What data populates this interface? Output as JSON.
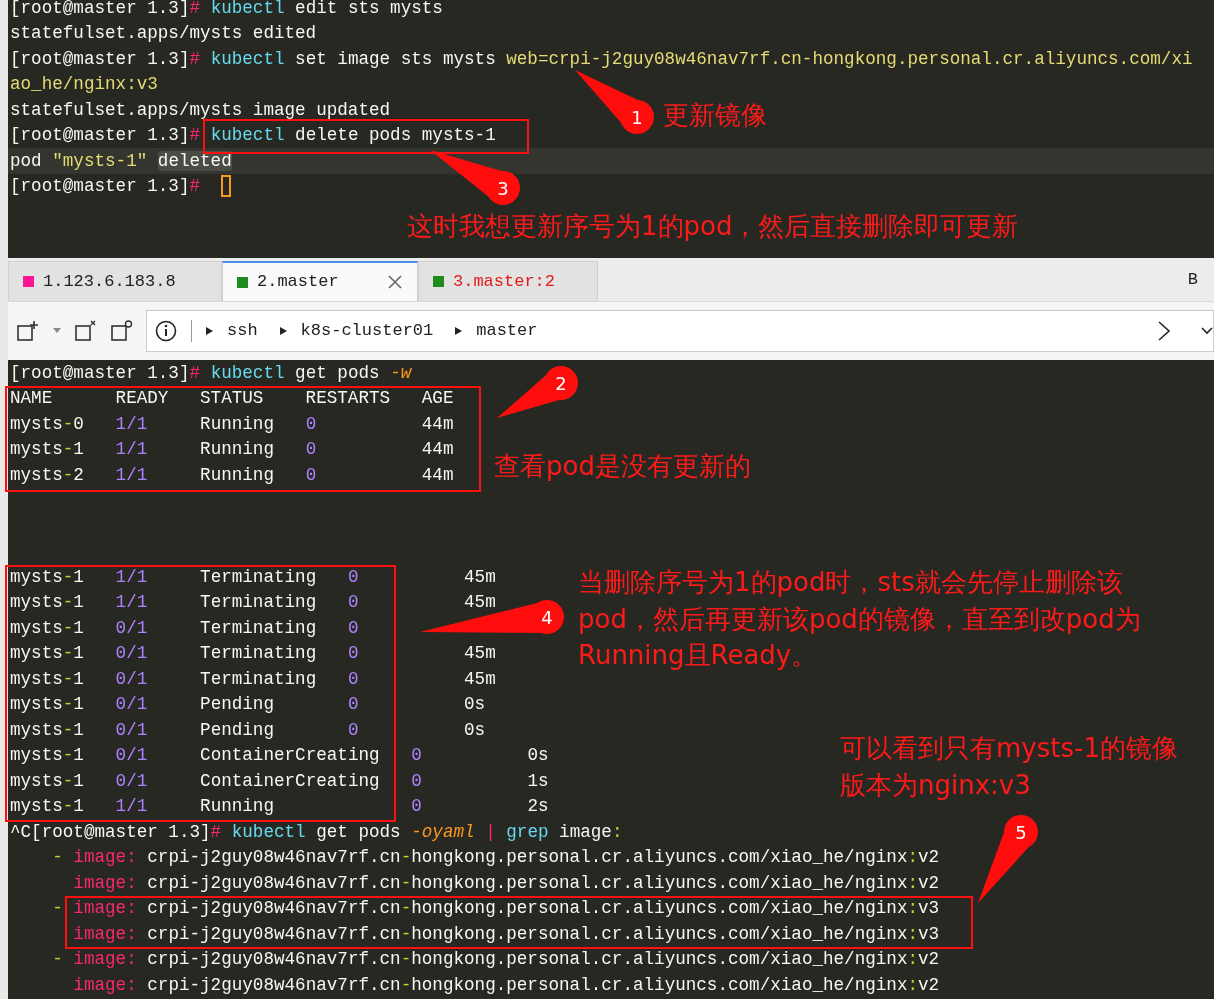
{
  "top_pane": {
    "lines": [
      {
        "kind": "text",
        "highlighted": false,
        "cursor": false,
        "segments": [
          {
            "kind": "plain",
            "text": "[root@master 1.3]"
          },
          {
            "kind": "prompt",
            "text": "# "
          },
          {
            "kind": "command",
            "text": "kubectl"
          },
          {
            "kind": "plain",
            "text": " edit sts mysts"
          }
        ]
      },
      {
        "kind": "text",
        "highlighted": false,
        "cursor": false,
        "segments": [
          {
            "kind": "plain",
            "text": "statefulset.apps/mysts edited"
          }
        ]
      },
      {
        "kind": "text",
        "highlighted": false,
        "cursor": false,
        "segments": [
          {
            "kind": "plain",
            "text": "[root@master 1.3]"
          },
          {
            "kind": "prompt",
            "text": "# "
          },
          {
            "kind": "command",
            "text": "kubectl"
          },
          {
            "kind": "plain",
            "text": " set image sts mysts "
          },
          {
            "kind": "string",
            "text": "web=crpi-j2guy08w46nav7rf.cn-hongkong.personal.cr.aliyuncs.com/xi"
          }
        ]
      },
      {
        "kind": "text",
        "highlighted": false,
        "cursor": false,
        "segments": [
          {
            "kind": "string",
            "text": "ao_he/nginx:v3"
          }
        ]
      },
      {
        "kind": "text",
        "highlighted": false,
        "cursor": false,
        "segments": [
          {
            "kind": "plain",
            "text": "statefulset.apps/mysts image updated"
          }
        ]
      },
      {
        "kind": "text",
        "highlighted": false,
        "cursor": false,
        "segments": [
          {
            "kind": "plain",
            "text": "[root@master 1.3]"
          },
          {
            "kind": "prompt",
            "text": "# "
          },
          {
            "kind": "command",
            "text": "kubectl"
          },
          {
            "kind": "plain",
            "text": " delete pods mysts-1"
          }
        ]
      },
      {
        "kind": "text",
        "highlighted": true,
        "cursor": false,
        "segments": [
          {
            "kind": "plain",
            "text": "pod "
          },
          {
            "kind": "string",
            "text": "\"mysts-1\" "
          },
          {
            "kind": "selected",
            "text": "deleted"
          }
        ]
      },
      {
        "kind": "text",
        "highlighted": false,
        "cursor": true,
        "segments": [
          {
            "kind": "plain",
            "text": "[root@master 1.3]"
          },
          {
            "kind": "prompt",
            "text": "# "
          }
        ]
      }
    ]
  },
  "tabs": [
    {
      "label": "1.123.6.183.8",
      "color": "#ff1493",
      "selected": false,
      "alert": false
    },
    {
      "label": "2.master",
      "color": "#1e8c1e",
      "selected": true,
      "alert": false
    },
    {
      "label": "3.master:2",
      "color": "#1e8c1e",
      "selected": false,
      "alert": true
    }
  ],
  "tab_bar_extra": "B",
  "breadcrumb": [
    "ssh",
    "k8s-cluster01",
    "master"
  ],
  "bottom_pane": {
    "lines": [
      {
        "kind": "text",
        "segments": [
          {
            "kind": "plain",
            "text": "[root@master 1.3]"
          },
          {
            "kind": "prompt",
            "text": "# "
          },
          {
            "kind": "command",
            "text": "kubectl"
          },
          {
            "kind": "plain",
            "text": " get pods "
          },
          {
            "kind": "flag",
            "text": "-w"
          }
        ]
      },
      {
        "kind": "text",
        "segments": [
          {
            "kind": "plain",
            "text": "NAME      READY   STATUS    RESTARTS   AGE"
          }
        ]
      },
      {
        "kind": "text",
        "segments": [
          {
            "kind": "plain",
            "text": "mysts"
          },
          {
            "kind": "dash",
            "text": "-"
          },
          {
            "kind": "plain",
            "text": "0   "
          },
          {
            "kind": "number",
            "text": "1/1"
          },
          {
            "kind": "plain",
            "text": "     Running   "
          },
          {
            "kind": "number",
            "text": "0"
          },
          {
            "kind": "plain",
            "text": "          44m"
          }
        ]
      },
      {
        "kind": "text",
        "segments": [
          {
            "kind": "plain",
            "text": "mysts"
          },
          {
            "kind": "dash",
            "text": "-"
          },
          {
            "kind": "plain",
            "text": "1   "
          },
          {
            "kind": "number",
            "text": "1/1"
          },
          {
            "kind": "plain",
            "text": "     Running   "
          },
          {
            "kind": "number",
            "text": "0"
          },
          {
            "kind": "plain",
            "text": "          44m"
          }
        ]
      },
      {
        "kind": "text",
        "segments": [
          {
            "kind": "plain",
            "text": "mysts"
          },
          {
            "kind": "dash",
            "text": "-"
          },
          {
            "kind": "plain",
            "text": "2   "
          },
          {
            "kind": "number",
            "text": "1/1"
          },
          {
            "kind": "plain",
            "text": "     Running   "
          },
          {
            "kind": "number",
            "text": "0"
          },
          {
            "kind": "plain",
            "text": "          44m"
          }
        ]
      },
      {
        "kind": "blank"
      },
      {
        "kind": "blank"
      },
      {
        "kind": "blank"
      },
      {
        "kind": "text",
        "segments": [
          {
            "kind": "plain",
            "text": "mysts"
          },
          {
            "kind": "dash",
            "text": "-"
          },
          {
            "kind": "plain",
            "text": "1   "
          },
          {
            "kind": "number",
            "text": "1/1"
          },
          {
            "kind": "plain",
            "text": "     Terminating   "
          },
          {
            "kind": "number",
            "text": "0"
          },
          {
            "kind": "plain",
            "text": "          45m"
          }
        ]
      },
      {
        "kind": "text",
        "segments": [
          {
            "kind": "plain",
            "text": "mysts"
          },
          {
            "kind": "dash",
            "text": "-"
          },
          {
            "kind": "plain",
            "text": "1   "
          },
          {
            "kind": "number",
            "text": "1/1"
          },
          {
            "kind": "plain",
            "text": "     Terminating   "
          },
          {
            "kind": "number",
            "text": "0"
          },
          {
            "kind": "plain",
            "text": "          45m"
          }
        ]
      },
      {
        "kind": "text",
        "segments": [
          {
            "kind": "plain",
            "text": "mysts"
          },
          {
            "kind": "dash",
            "text": "-"
          },
          {
            "kind": "plain",
            "text": "1   "
          },
          {
            "kind": "number",
            "text": "0/1"
          },
          {
            "kind": "plain",
            "text": "     Terminating   "
          },
          {
            "kind": "number",
            "text": "0"
          }
        ]
      },
      {
        "kind": "text",
        "segments": [
          {
            "kind": "plain",
            "text": "mysts"
          },
          {
            "kind": "dash",
            "text": "-"
          },
          {
            "kind": "plain",
            "text": "1   "
          },
          {
            "kind": "number",
            "text": "0/1"
          },
          {
            "kind": "plain",
            "text": "     Terminating   "
          },
          {
            "kind": "number",
            "text": "0"
          },
          {
            "kind": "plain",
            "text": "          45m"
          }
        ]
      },
      {
        "kind": "text",
        "segments": [
          {
            "kind": "plain",
            "text": "mysts"
          },
          {
            "kind": "dash",
            "text": "-"
          },
          {
            "kind": "plain",
            "text": "1   "
          },
          {
            "kind": "number",
            "text": "0/1"
          },
          {
            "kind": "plain",
            "text": "     Terminating   "
          },
          {
            "kind": "number",
            "text": "0"
          },
          {
            "kind": "plain",
            "text": "          45m"
          }
        ]
      },
      {
        "kind": "text",
        "segments": [
          {
            "kind": "plain",
            "text": "mysts"
          },
          {
            "kind": "dash",
            "text": "-"
          },
          {
            "kind": "plain",
            "text": "1   "
          },
          {
            "kind": "number",
            "text": "0/1"
          },
          {
            "kind": "plain",
            "text": "     Pending       "
          },
          {
            "kind": "number",
            "text": "0"
          },
          {
            "kind": "plain",
            "text": "          0s"
          }
        ]
      },
      {
        "kind": "text",
        "segments": [
          {
            "kind": "plain",
            "text": "mysts"
          },
          {
            "kind": "dash",
            "text": "-"
          },
          {
            "kind": "plain",
            "text": "1   "
          },
          {
            "kind": "number",
            "text": "0/1"
          },
          {
            "kind": "plain",
            "text": "     Pending       "
          },
          {
            "kind": "number",
            "text": "0"
          },
          {
            "kind": "plain",
            "text": "          0s"
          }
        ]
      },
      {
        "kind": "text",
        "segments": [
          {
            "kind": "plain",
            "text": "mysts"
          },
          {
            "kind": "dash",
            "text": "-"
          },
          {
            "kind": "plain",
            "text": "1   "
          },
          {
            "kind": "number",
            "text": "0/1"
          },
          {
            "kind": "plain",
            "text": "     ContainerCreating   "
          },
          {
            "kind": "number",
            "text": "0"
          },
          {
            "kind": "plain",
            "text": "          0s"
          }
        ]
      },
      {
        "kind": "text",
        "segments": [
          {
            "kind": "plain",
            "text": "mysts"
          },
          {
            "kind": "dash",
            "text": "-"
          },
          {
            "kind": "plain",
            "text": "1   "
          },
          {
            "kind": "number",
            "text": "0/1"
          },
          {
            "kind": "plain",
            "text": "     ContainerCreating   "
          },
          {
            "kind": "number",
            "text": "0"
          },
          {
            "kind": "plain",
            "text": "          1s"
          }
        ]
      },
      {
        "kind": "text",
        "segments": [
          {
            "kind": "plain",
            "text": "mysts"
          },
          {
            "kind": "dash",
            "text": "-"
          },
          {
            "kind": "plain",
            "text": "1   "
          },
          {
            "kind": "number",
            "text": "1/1"
          },
          {
            "kind": "plain",
            "text": "     Running             "
          },
          {
            "kind": "number",
            "text": "0"
          },
          {
            "kind": "plain",
            "text": "          2s"
          }
        ]
      },
      {
        "kind": "text",
        "segments": [
          {
            "kind": "plain",
            "text": "^C[root@master 1.3]"
          },
          {
            "kind": "prompt",
            "text": "# "
          },
          {
            "kind": "command",
            "text": "kubectl"
          },
          {
            "kind": "plain",
            "text": " get pods "
          },
          {
            "kind": "flag",
            "text": "-oyaml"
          },
          {
            "kind": "key",
            "text": " | "
          },
          {
            "kind": "command",
            "text": "grep"
          },
          {
            "kind": "plain",
            "text": " image"
          },
          {
            "kind": "dash",
            "text": ":"
          }
        ]
      },
      {
        "kind": "text",
        "segments": [
          {
            "kind": "bullet",
            "text": "    -"
          },
          {
            "kind": "key",
            "text": " image:"
          },
          {
            "kind": "plain",
            "text": " crpi-j2guy08w46nav7rf.cn"
          },
          {
            "kind": "dash",
            "text": "-"
          },
          {
            "kind": "plain",
            "text": "hongkong.personal.cr.aliyuncs.com/xiao_he/nginx"
          },
          {
            "kind": "dash",
            "text": ":"
          },
          {
            "kind": "plain",
            "text": "v2"
          }
        ]
      },
      {
        "kind": "text",
        "segments": [
          {
            "kind": "key",
            "text": "      image:"
          },
          {
            "kind": "plain",
            "text": " crpi-j2guy08w46nav7rf.cn"
          },
          {
            "kind": "dash",
            "text": "-"
          },
          {
            "kind": "plain",
            "text": "hongkong.personal.cr.aliyuncs.com/xiao_he/nginx"
          },
          {
            "kind": "dash",
            "text": ":"
          },
          {
            "kind": "plain",
            "text": "v2"
          }
        ]
      },
      {
        "kind": "text",
        "segments": [
          {
            "kind": "bullet",
            "text": "    -"
          },
          {
            "kind": "key",
            "text": " image:"
          },
          {
            "kind": "plain",
            "text": " crpi-j2guy08w46nav7rf.cn"
          },
          {
            "kind": "dash",
            "text": "-"
          },
          {
            "kind": "plain",
            "text": "hongkong.personal.cr.aliyuncs.com/xiao_he/nginx"
          },
          {
            "kind": "dash",
            "text": ":"
          },
          {
            "kind": "plain",
            "text": "v3"
          }
        ]
      },
      {
        "kind": "text",
        "segments": [
          {
            "kind": "key",
            "text": "      image:"
          },
          {
            "kind": "plain",
            "text": " crpi-j2guy08w46nav7rf.cn"
          },
          {
            "kind": "dash",
            "text": "-"
          },
          {
            "kind": "plain",
            "text": "hongkong.personal.cr.aliyuncs.com/xiao_he/nginx"
          },
          {
            "kind": "dash",
            "text": ":"
          },
          {
            "kind": "plain",
            "text": "v3"
          }
        ]
      },
      {
        "kind": "text",
        "segments": [
          {
            "kind": "bullet",
            "text": "    -"
          },
          {
            "kind": "key",
            "text": " image:"
          },
          {
            "kind": "plain",
            "text": " crpi-j2guy08w46nav7rf.cn"
          },
          {
            "kind": "dash",
            "text": "-"
          },
          {
            "kind": "plain",
            "text": "hongkong.personal.cr.aliyuncs.com/xiao_he/nginx"
          },
          {
            "kind": "dash",
            "text": ":"
          },
          {
            "kind": "plain",
            "text": "v2"
          }
        ]
      },
      {
        "kind": "text",
        "segments": [
          {
            "kind": "key",
            "text": "      image:"
          },
          {
            "kind": "plain",
            "text": " crpi-j2guy08w46nav7rf.cn"
          },
          {
            "kind": "dash",
            "text": "-"
          },
          {
            "kind": "plain",
            "text": "hongkong.personal.cr.aliyuncs.com/xiao_he/nginx"
          },
          {
            "kind": "dash",
            "text": ":"
          },
          {
            "kind": "plain",
            "text": "v2"
          }
        ]
      }
    ]
  },
  "annotations": [
    {
      "number": "1",
      "text": "更新镜像"
    },
    {
      "number": "3",
      "text": "这时我想更新序号为1的pod，然后直接删除即可更新"
    },
    {
      "number": "2",
      "text": "查看pod是没有更新的"
    },
    {
      "number": "4",
      "text": "当删除序号为1的pod时，sts就会先停止删除该pod，然后再更新该pod的镜像，直至到改pod为Running且Ready。"
    },
    {
      "number": "5",
      "text": "可以看到只有mysts-1的镜像版本为nginx:v3"
    }
  ]
}
